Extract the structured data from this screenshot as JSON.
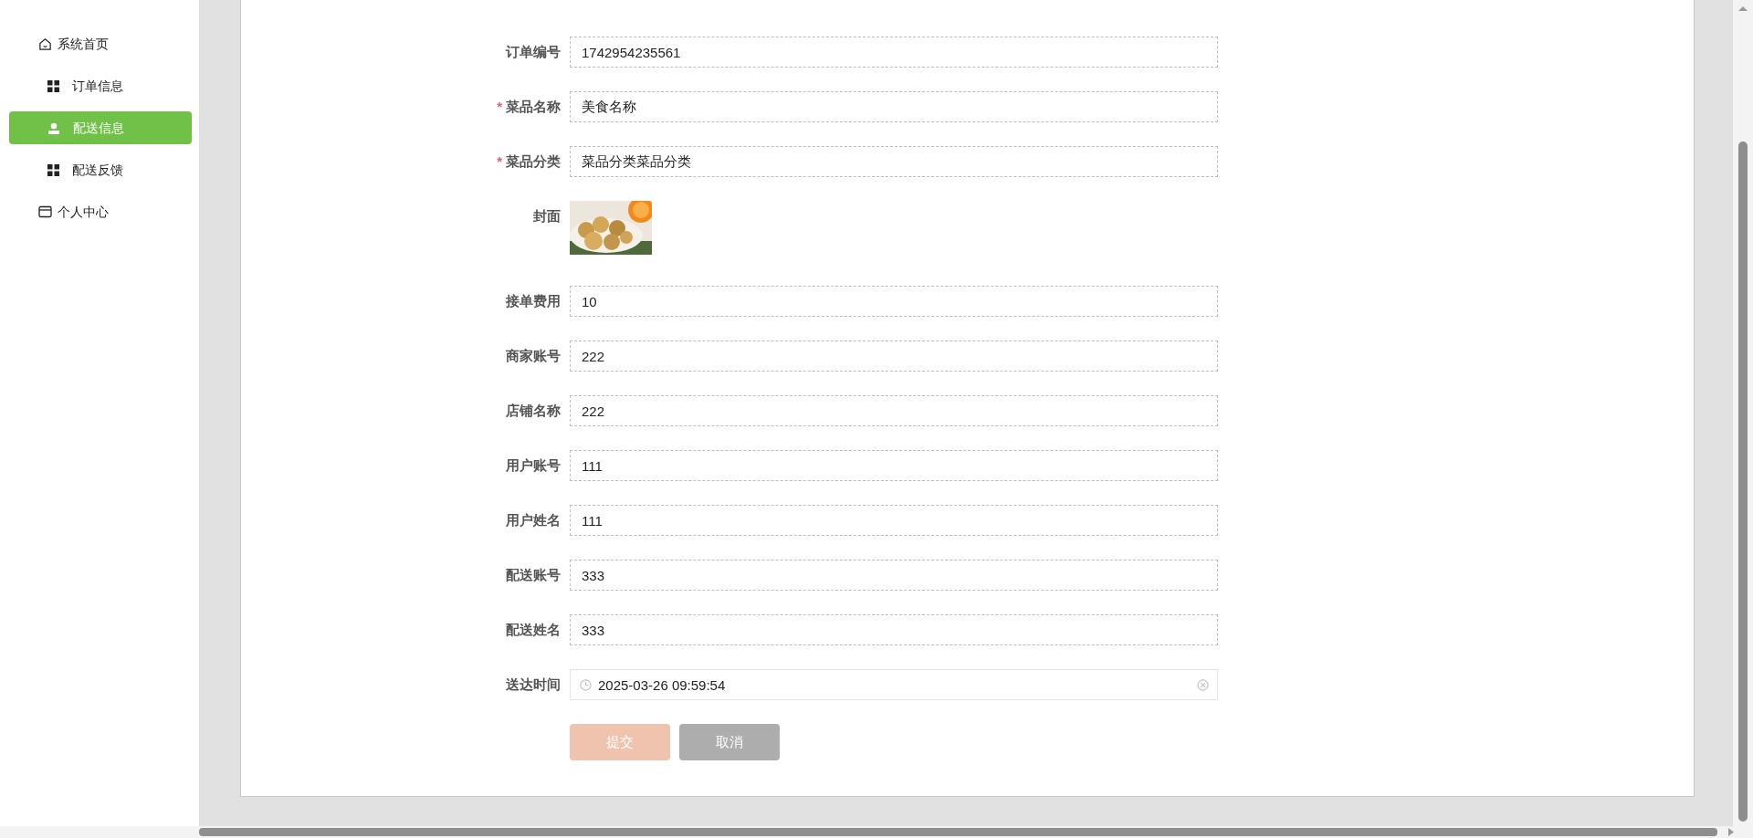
{
  "sidebar": {
    "items": [
      {
        "label": "系统首页",
        "kind": "house",
        "selected": false
      },
      {
        "label": "订单信息",
        "kind": "grid",
        "selected": false
      },
      {
        "label": "配送信息",
        "kind": "person",
        "selected": true
      },
      {
        "label": "配送反馈",
        "kind": "grid",
        "selected": false
      },
      {
        "label": "个人中心",
        "kind": "card",
        "selected": false
      }
    ]
  },
  "form": {
    "fields": [
      {
        "label": "订单编号",
        "kind": "text",
        "value": "1742954235561"
      },
      {
        "label": "菜品名称",
        "kind": "text",
        "required_mark": "*",
        "value": "美食名称"
      },
      {
        "label": "菜品分类",
        "kind": "text",
        "required_mark": "*",
        "value": "菜品分类菜品分类"
      },
      {
        "label": "封面"
      },
      {
        "label": "接单费用",
        "kind": "text",
        "value": "10"
      },
      {
        "label": "商家账号",
        "kind": "text",
        "value": "222"
      },
      {
        "label": "店铺名称",
        "kind": "text",
        "value": "222"
      },
      {
        "label": "用户账号",
        "kind": "text",
        "value": "111"
      },
      {
        "label": "用户姓名",
        "kind": "text",
        "value": "111"
      },
      {
        "label": "配送账号",
        "kind": "text",
        "value": "333"
      },
      {
        "label": "配送姓名",
        "kind": "text",
        "value": "333"
      },
      {
        "label": "送达时间",
        "kind": "datetime",
        "value": "2025-03-26 09:59:54"
      }
    ],
    "buttons": [
      {
        "label": "提交",
        "kind": "submit"
      },
      {
        "label": "取消",
        "kind": "cancel"
      }
    ]
  }
}
